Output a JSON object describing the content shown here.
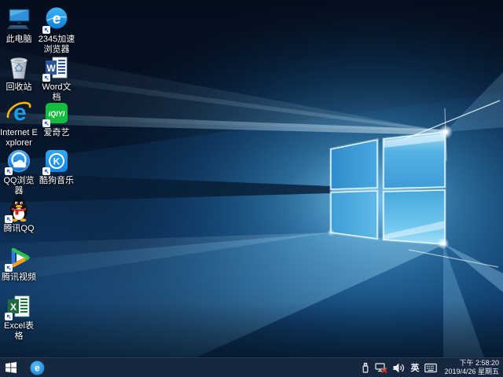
{
  "desktop": {
    "icons": [
      {
        "name": "this-pc",
        "label": "此电脑"
      },
      {
        "name": "2345-browser",
        "label": "2345加速浏览器",
        "glyph": "e"
      },
      {
        "name": "recycle-bin",
        "label": "回收站"
      },
      {
        "name": "word",
        "label": "Word文档",
        "glyph": "W"
      },
      {
        "name": "internet-explorer",
        "label": "Internet Explorer",
        "glyph": "e"
      },
      {
        "name": "iqiyi",
        "label": "爱奇艺",
        "glyph": "iQIYI"
      },
      {
        "name": "qq-browser",
        "label": "QQ浏览器"
      },
      {
        "name": "kugou-music",
        "label": "酷狗音乐",
        "glyph": "K"
      },
      {
        "name": "tencent-qq",
        "label": "腾讯QQ"
      },
      {
        "name": "tencent-video",
        "label": "腾讯视频"
      },
      {
        "name": "excel",
        "label": "Excel表格",
        "glyph": "X"
      }
    ]
  },
  "taskbar": {
    "pinned": [
      {
        "name": "e-browser",
        "glyph": "e"
      }
    ],
    "tray": {
      "icons": [
        "usb-device",
        "network-disconnected",
        "volume",
        "ime",
        "touch-keyboard"
      ],
      "ime": "英",
      "time": "下午 2:58:20",
      "date": "2019/4/26 星期五"
    }
  },
  "colors": {
    "taskbar": "#17273e",
    "wallpaper_dark": "#071a30",
    "wallpaper_glow": "#5cc0f2",
    "pane_stroke": "#eaf8ff",
    "accent_blue": "#1a9be8"
  }
}
